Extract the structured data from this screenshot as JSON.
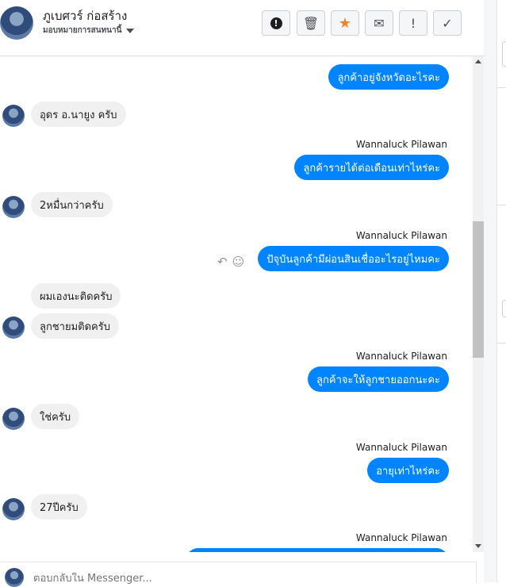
{
  "header": {
    "title": "ภูเบศวร์ ก่อสร้าง",
    "subtitle": "มอบหมายการสนทนานี้",
    "toolbar": [
      {
        "name": "report-button",
        "icon": "exclamation-circle-icon"
      },
      {
        "name": "delete-button",
        "icon": "trash-icon",
        "glyph": "🗑"
      },
      {
        "name": "star-button",
        "icon": "star-icon",
        "glyph": "★"
      },
      {
        "name": "email-button",
        "icon": "envelope-icon",
        "glyph": "✉"
      },
      {
        "name": "mark-spam-button",
        "icon": "exclamation-icon",
        "glyph": "!"
      },
      {
        "name": "done-button",
        "icon": "check-icon",
        "glyph": "✓"
      }
    ]
  },
  "messages": [
    {
      "type": "out",
      "text": "ลูกค้าอยู่จังหวัดอะไรคะ"
    },
    {
      "type": "in",
      "text": "อุดร อ.นายูง ครับ"
    },
    {
      "type": "out",
      "sender": "Wannaluck Pilawan",
      "text": "ลูกค้ารายได้ต่อเดือนเท่าไหร่คะ"
    },
    {
      "type": "in",
      "text": "2หมื่นกว่าครับ"
    },
    {
      "type": "out",
      "sender": "Wannaluck Pilawan",
      "text": "ปัจุบันลูกค้ามีผ่อนสินเชื่ออะไรอยู่ไหมคะ"
    },
    {
      "type": "in",
      "text": "ผมเองนะติดครับ"
    },
    {
      "type": "in",
      "text": "ลูกชายมติดครับ"
    },
    {
      "type": "out",
      "sender": "Wannaluck Pilawan",
      "text": "ลูกค้าจะให้ลูกชายออกนะคะ"
    },
    {
      "type": "in",
      "text": "ใช่ครับ"
    },
    {
      "type": "out",
      "sender": "Wannaluck Pilawan",
      "text": "อายุเท่าไหร่คะ"
    },
    {
      "type": "in",
      "text": "27ปีครับ"
    },
    {
      "type": "out",
      "sender": "Wannaluck Pilawan",
      "text": ""
    }
  ],
  "composer": {
    "placeholder": "ตอบกลับใน Messenger..."
  },
  "colors": {
    "accent": "#0084ff",
    "incoming_bubble": "#f1f0f0",
    "star": "#f0842c"
  }
}
